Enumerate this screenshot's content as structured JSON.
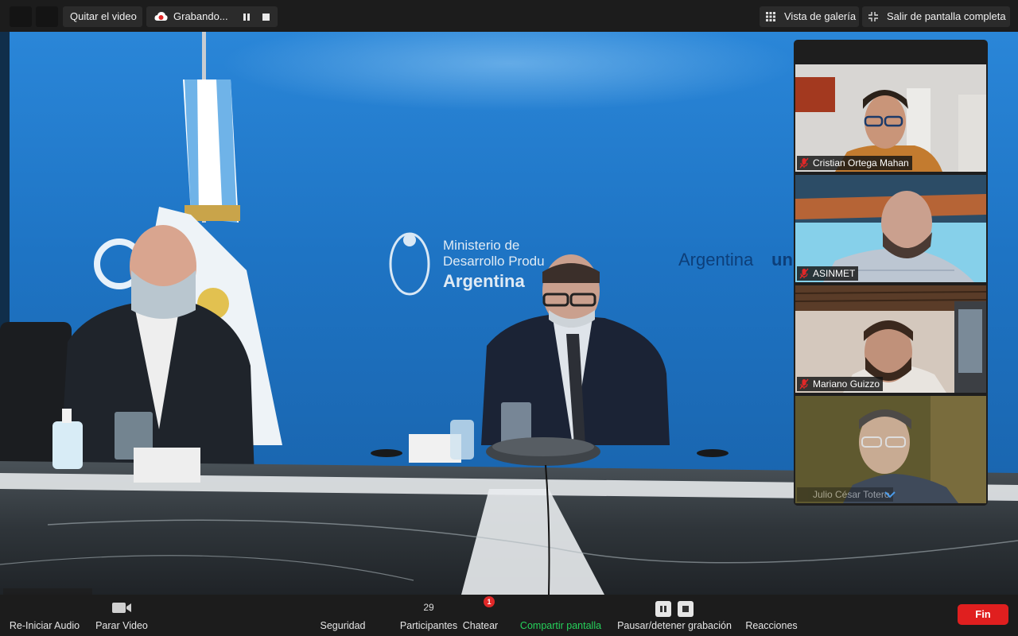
{
  "top_bar": {
    "stop_video_label": "Quitar el video",
    "recording_label": "Grabando...",
    "gallery_view_label": "Vista de galería",
    "exit_fullscreen_label": "Salir de pantalla completa"
  },
  "main_video": {
    "backdrop_line1": "Ministerio de",
    "backdrop_line2": "Desarrollo Produ",
    "backdrop_line3": "Argentina",
    "backdrop_right": "Argentina",
    "backdrop_right_suffix": "un"
  },
  "participants": [
    {
      "name": "Cristian Ortega Mahan",
      "muted": true
    },
    {
      "name": "ASINMET",
      "muted": true
    },
    {
      "name": "Mariano Guizzo",
      "muted": true
    },
    {
      "name": "Julio César Totero",
      "muted": false
    }
  ],
  "toolbar": {
    "audio_label": "Re-Iniciar Audio",
    "video_label": "Parar Video",
    "security_label": "Seguridad",
    "participants_count": "29",
    "participants_label": "Participantes",
    "chat_badge": "1",
    "chat_label": "Chatear",
    "share_label": "Compartir pantalla",
    "recording_label": "Pausar/detener grabación",
    "reactions_label": "Reacciones",
    "end_label": "Fin"
  },
  "colors": {
    "share_green": "#26d15b",
    "end_red": "#e01f1f",
    "badge_red": "#e02828",
    "backdrop_blue": "#1f78c8"
  }
}
